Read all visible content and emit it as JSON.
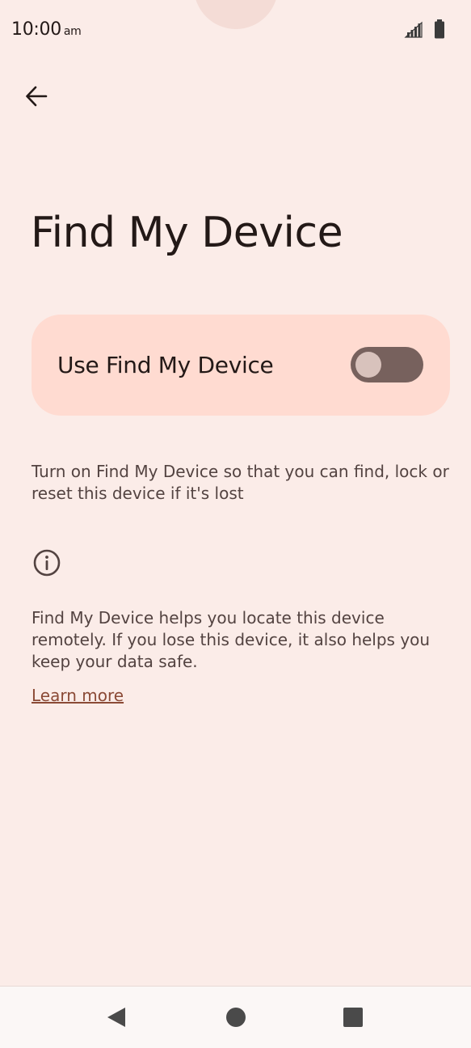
{
  "status_bar": {
    "time": "10:00",
    "ampm": "am",
    "signal_icon": "signal-icon",
    "battery_icon": "battery-icon"
  },
  "header": {
    "back_icon": "arrow-back-icon",
    "title": "Find My Device"
  },
  "toggle": {
    "label": "Use Find My Device",
    "state": "off"
  },
  "description": "Turn on Find My Device so that you can find, lock or reset this device if it's lost",
  "info": {
    "icon": "info-icon",
    "text": "Find My Device helps you locate this device remotely. If you lose this device, it also helps you keep your data safe.",
    "link_label": "Learn more"
  },
  "nav_bar": {
    "back_icon": "nav-back-icon",
    "home_icon": "nav-home-icon",
    "recents_icon": "nav-recents-icon"
  },
  "colors": {
    "background": "#FBECE8",
    "card": "#FFDBD1",
    "switch_track": "#77615D",
    "switch_thumb": "#D8C2BC",
    "link": "#8B4A36"
  }
}
